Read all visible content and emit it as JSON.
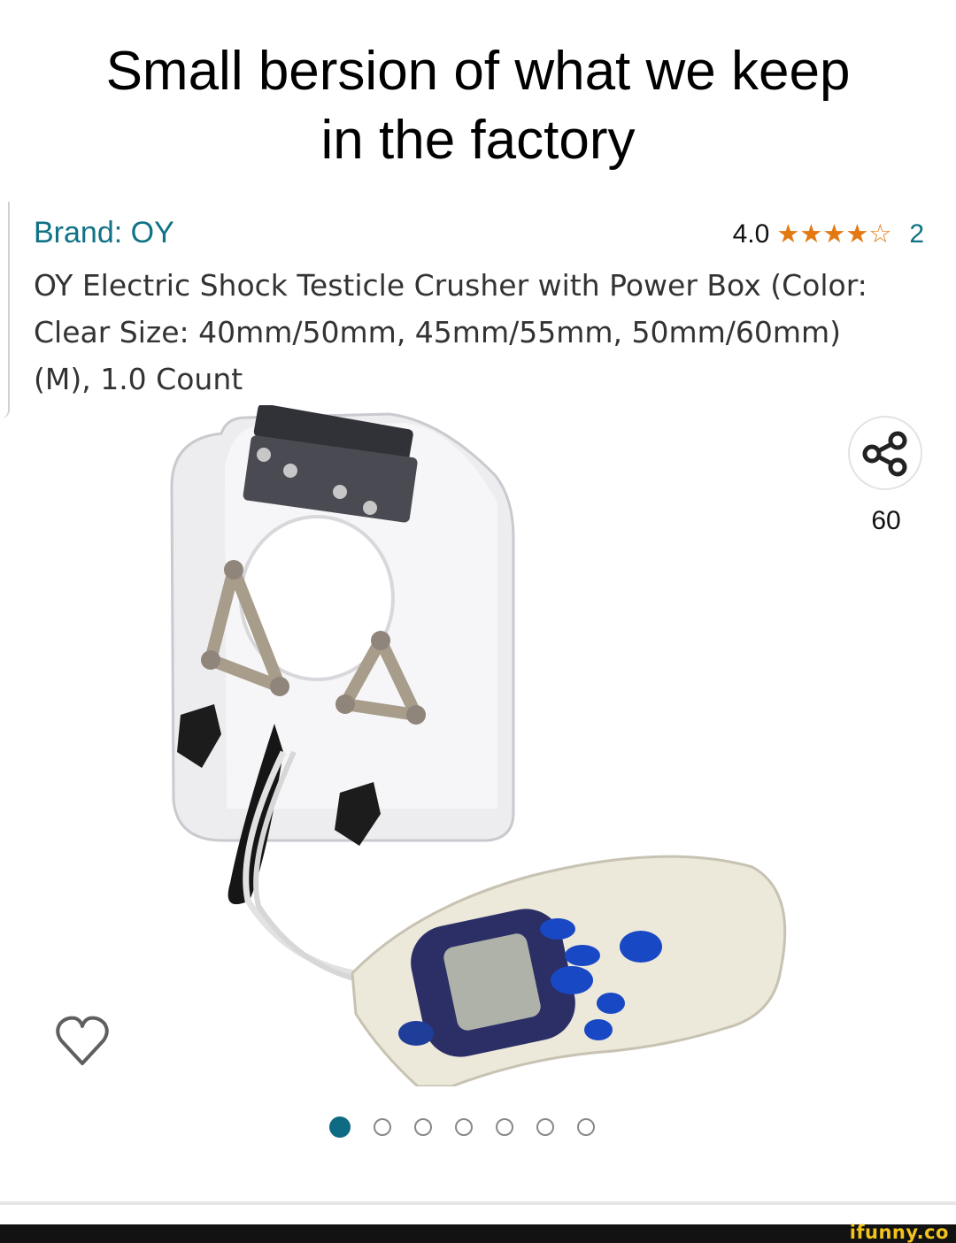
{
  "caption": {
    "line1": "Small bersion of what we keep",
    "line2": "in the factory"
  },
  "product": {
    "brand": "Brand: OY",
    "rating_value": "4.0",
    "rating_stars": 4,
    "rating_max": 5,
    "rating_count": "2",
    "title_line1": "OY Electric Shock Testicle Crusher with Power Box (Color:",
    "title_line2": "Clear Size: 40mm/50mm, 45mm/55mm, 50mm/60mm)",
    "title_line3": "(M), 1.0 Count",
    "share_count": "60",
    "image_pages": 7,
    "current_image": 1
  },
  "icons": {
    "share": "share-icon",
    "heart": "heart-icon",
    "star": "star-icon"
  },
  "colors": {
    "link": "#0f7285",
    "star": "#e47911",
    "active_dot": "#0f6b83",
    "watermark": "#f2c31b"
  },
  "watermark": "ifunny.co"
}
